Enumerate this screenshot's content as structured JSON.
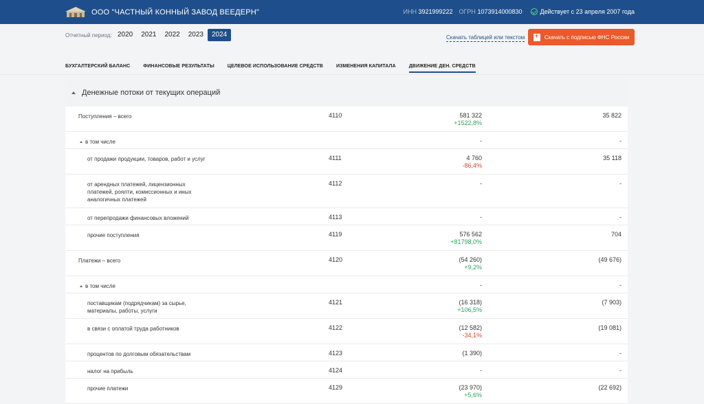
{
  "header": {
    "company": "ООО \"ЧАСТНЫЙ КОННЫЙ ЗАВОД ВЕЕДЕРН\"",
    "inn_label": "ИНН",
    "inn": "3921999222",
    "ogrn_label": "ОГРН",
    "ogrn": "1073914000830",
    "status": "Действует с 23 апреля 2007 года"
  },
  "period": {
    "label": "Отчетный период:",
    "years": [
      "2020",
      "2021",
      "2022",
      "2023",
      "2024"
    ],
    "selected": "2024"
  },
  "actions": {
    "download_table": "Скачать таблицей или текстом",
    "download_signed": "Скачать с подписью ФНС России"
  },
  "tabs": [
    "БУХГАЛТЕРСКИЙ БАЛАНС",
    "ФИНАНСОВЫЕ РЕЗУЛЬТАТЫ",
    "ЦЕЛЕВОЕ ИСПОЛЬЗОВАНИЕ СРЕДСТВ",
    "ИЗМЕНЕНИЯ КАПИТАЛА",
    "ДВИЖЕНИЕ ДЕН. СРЕДСТВ"
  ],
  "active_tab": "ДВИЖЕНИЕ ДЕН. СРЕДСТВ",
  "section": {
    "title": "Денежные потоки от текущих операций"
  },
  "rows": [
    {
      "name": "Поступления – всего",
      "code": "4110",
      "v1": "581 322",
      "delta": "+1522,8%",
      "v2": "35 822"
    },
    {
      "name": "в том числе",
      "code": "",
      "v1": "-",
      "delta": "",
      "v2": "-"
    },
    {
      "name": "от продажи продукции, товаров, работ и услуг",
      "code": "4111",
      "v1": "4 760",
      "delta": "-86,4%",
      "v2": "35 118"
    },
    {
      "name": "от арендных платежей, лицензионных платежей, роялти, комиссионных и иных аналогичных платежей",
      "code": "4112",
      "v1": "-",
      "delta": "",
      "v2": "-"
    },
    {
      "name": "от перепродажи финансовых вложений",
      "code": "4113",
      "v1": "-",
      "delta": "",
      "v2": "-"
    },
    {
      "name": "прочие поступления",
      "code": "4119",
      "v1": "576 562",
      "delta": "+81798,0%",
      "v2": "704"
    },
    {
      "name": "Платежи – всего",
      "code": "4120",
      "v1": "(54 260)",
      "delta": "+9,2%",
      "v2": "(49 676)"
    },
    {
      "name": "в том числе",
      "code": "",
      "v1": "-",
      "delta": "",
      "v2": "-"
    },
    {
      "name": "поставщикам (подрядчикам) за сырье, материалы, работы, услуги",
      "code": "4121",
      "v1": "(16 318)",
      "delta": "+106,5%",
      "v2": "(7 903)"
    },
    {
      "name": "в связи с оплатой труда работников",
      "code": "4122",
      "v1": "(12 582)",
      "delta": "-34,1%",
      "v2": "(19 081)"
    },
    {
      "name": "процентов по долговым обязательствам",
      "code": "4123",
      "v1": "(1 390)",
      "delta": "",
      "v2": "-"
    },
    {
      "name": "налог на прибыль",
      "code": "4124",
      "v1": "-",
      "delta": "",
      "v2": "-"
    },
    {
      "name": "прочие платежи",
      "code": "4129",
      "v1": "(23 970)",
      "delta": "+5,6%",
      "v2": "(22 692)"
    }
  ]
}
